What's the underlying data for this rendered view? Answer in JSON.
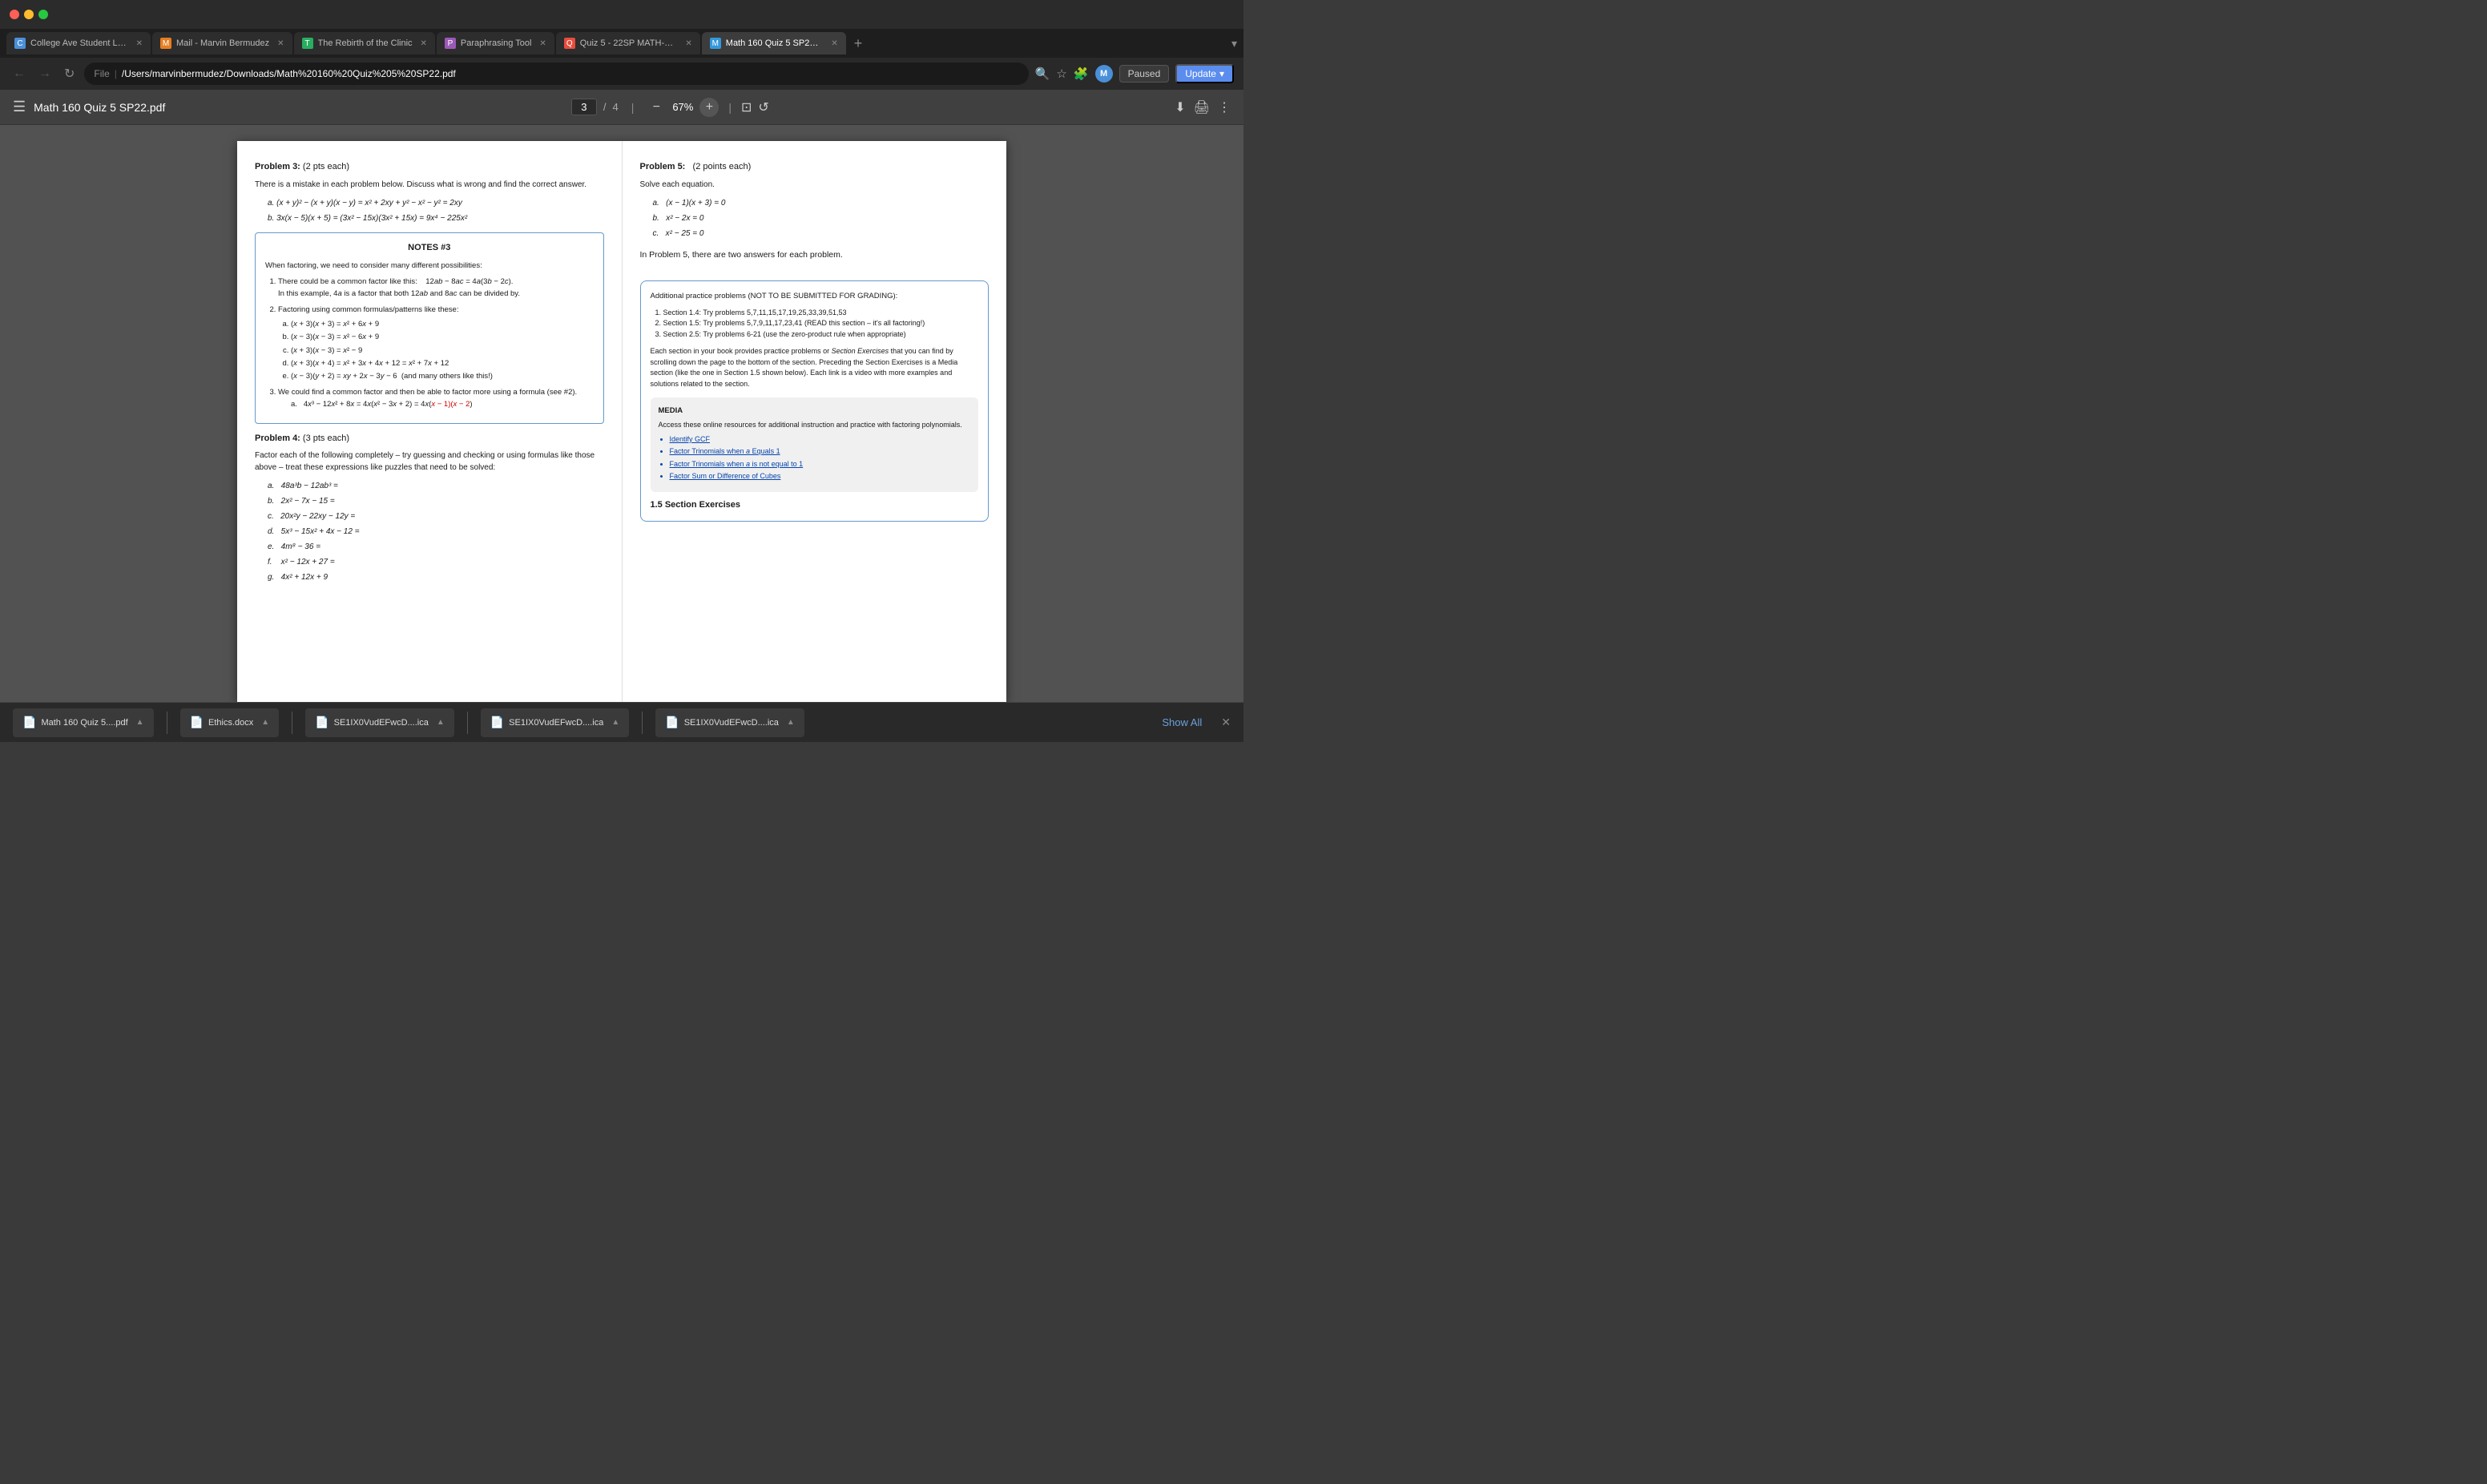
{
  "titlebar": {
    "traffic": [
      "red",
      "yellow",
      "green"
    ]
  },
  "tabs": [
    {
      "id": "tab1",
      "label": "College Ave Student Loa...",
      "icon_color": "#4a90d9",
      "icon_text": "C",
      "active": false
    },
    {
      "id": "tab2",
      "label": "Mail - Marvin Bermudez",
      "icon_color": "#e67e22",
      "icon_text": "M",
      "active": false
    },
    {
      "id": "tab3",
      "label": "The Rebirth of the Clinic",
      "icon_color": "#27ae60",
      "icon_text": "T",
      "active": false
    },
    {
      "id": "tab4",
      "label": "Paraphrasing Tool",
      "icon_color": "#9b59b6",
      "icon_text": "P",
      "active": false
    },
    {
      "id": "tab5",
      "label": "Quiz 5 - 22SP MATH-16...",
      "icon_color": "#e74c3c",
      "icon_text": "Q",
      "active": false
    },
    {
      "id": "tab6",
      "label": "Math 160 Quiz 5 SP22.p...",
      "icon_color": "#3498db",
      "icon_text": "M",
      "active": true
    }
  ],
  "addressbar": {
    "back_btn": "←",
    "forward_btn": "→",
    "reload_btn": "↻",
    "file_label": "File",
    "path": "/Users/marvinbermudez/Downloads/Math%20160%20Quiz%205%20SP22.pdf",
    "avatar_letter": "M",
    "paused_label": "Paused",
    "update_label": "Update"
  },
  "pdf_toolbar": {
    "title": "Math 160 Quiz 5 SP22.pdf",
    "current_page": "3",
    "total_pages": "4",
    "zoom_level": "67%",
    "zoom_minus": "−",
    "zoom_plus": "+"
  },
  "pdf_content": {
    "left_col": {
      "problem3_title": "Problem 3:",
      "problem3_pts": "(2 pts each)",
      "problem3_desc": "There is a mistake in each problem below.  Discuss what is wrong and find the correct answer.",
      "eq_a": "a.   (x + y)² − (x + y)(x − y) = x² + 2xy + y² − x² − y² = 2xy",
      "eq_b": "b.   3x(x − 5)(x + 5) = (3x² − 15x)(3x² + 15x) = 9x⁴ − 225x²",
      "notes_title": "NOTES #3",
      "notes_intro": "When factoring, we need to consider many different possibilities:",
      "notes_items": [
        {
          "text": "There could be a common factor like this:   12ab − 8ac = 4a(3b − 2c).",
          "sub": "In this example, 4a is a factor that both 12ab and 8ac can be divided by."
        },
        {
          "text": "Factoring using common formulas/patterns like these:",
          "subs": [
            "(x + 3)(x + 3) = x² + 6x + 9",
            "(x − 3)(x − 3) = x² − 6x + 9",
            "(x + 3)(x − 3) = x² − 9",
            "(x + 3)(x + 4) = x² + 3x + 4x + 12 = x² + 7x + 12",
            "(x − 3)(y + 2) = xy + 2x − 3y − 6  (and many others like this!)"
          ]
        },
        {
          "text": "We could find a common factor and then be able to factor more using a formula (see #2).",
          "sub": "4x³ − 12x² + 8x = 4x(x² − 3x + 2) = 4x(x − 1)(x − 2)"
        }
      ],
      "problem4_title": "Problem 4:",
      "problem4_pts": "(3 pts each)",
      "problem4_desc": "Factor each of the following completely – try guessing and checking or using formulas like those above – treat these expressions like puzzles that need to be solved:",
      "problem4_parts": [
        "a.   48a³b − 12ab³ =",
        "b.   2x² − 7x − 15 =",
        "c.   20x²y − 22xy − 12y =",
        "d.   5x³ − 15x² + 4x − 12 =",
        "e.   4m⁸ − 36 =",
        "f.    x² − 12x + 27 =",
        "g.   4x² + 12x + 9"
      ]
    },
    "right_col": {
      "problem5_title": "Problem 5:",
      "problem5_pts": "(2 points each)",
      "problem5_desc": "Solve each equation.",
      "problem5_parts": [
        "a.   (x − 1)(x + 3) = 0",
        "b.   x² − 2x = 0",
        "c.   x² − 25 = 0"
      ],
      "problem5_note": "In Problem 5, there are two answers for each problem.",
      "practice_title": "Additional practice problems (NOT TO BE SUBMITTED FOR GRADING):",
      "practice_items": [
        "Section 1.4: Try problems 5,7,11,15,17,19,25,33,39,51,53",
        "Section 1.5: Try problems 5,7,9,11,17,23,41 (READ this section – it's all factoring!)",
        "Section 2.5: Try problems 6-21 (use the zero-product rule when appropriate)"
      ],
      "practice_desc": "Each section in your book provides practice problems or Section Exercises that you can find by scrolling down the page to the bottom of the section. Preceding the Section Exercises is a Media section (like the one in Section 1.5 shown below). Each link is a video with more examples and solutions related to the section.",
      "media_title": "MEDIA",
      "media_desc": "Access these online resources for additional instruction and practice with factoring polynomials.",
      "media_links": [
        "Identify GCF",
        "Factor Trinomials when a Equals 1",
        "Factor Trinomials when a is not equal to 1",
        "Factor Sum or Difference of Cubes"
      ],
      "section_exercises": "1.5 Section Exercises"
    }
  },
  "download_bar": {
    "items": [
      {
        "id": "dl1",
        "icon": "📄",
        "label": "Math 160 Quiz 5....pdf",
        "color": "#e74c3c"
      },
      {
        "id": "dl2",
        "icon": "📄",
        "label": "Ethics.docx",
        "color": "#4a90d9"
      },
      {
        "id": "dl3",
        "icon": "📄",
        "label": "SE1IX0VudEFwcD....ica",
        "color": "#666"
      },
      {
        "id": "dl4",
        "icon": "📄",
        "label": "SE1IX0VudEFwcD....ica",
        "color": "#666"
      },
      {
        "id": "dl5",
        "icon": "📄",
        "label": "SE1IX0VudEFwcD....ica",
        "color": "#666"
      }
    ],
    "show_all_label": "Show All",
    "close_label": "✕"
  }
}
